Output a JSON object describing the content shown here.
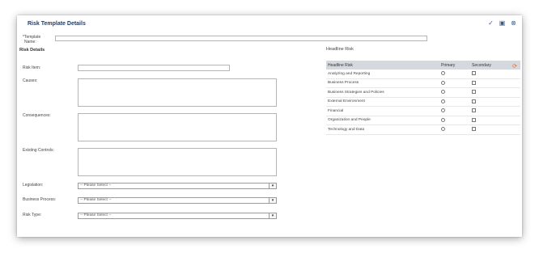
{
  "dialog": {
    "title": "Risk Template Details",
    "icons": [
      "spellcheck-icon",
      "save-icon",
      "close-icon"
    ]
  },
  "form": {
    "template_name_label_1": "*Template",
    "template_name_label_2": "Name:",
    "template_name_value": "",
    "section_title": "Risk Details",
    "risk_item_label": "Risk Item:",
    "causes_label": "Causes:",
    "consequences_label": "Consequences:",
    "existing_controls_label": "Existing Controls:",
    "legislation_label": "Legislation:",
    "legislation_value": "-- Please Select --",
    "business_process_label": "Business Process:",
    "business_process_value": "-- Please Select --",
    "risk_type_label": "Risk Type:",
    "risk_type_value": "-- Please Select --"
  },
  "headline": {
    "section_title": "Headline Risk",
    "columns": {
      "name": "Headline Risk",
      "primary": "Primary",
      "secondary": "Secondary"
    },
    "rows": [
      "Analyzing and Reporting",
      "Business Process",
      "Business Strategies and Policies",
      "External Environment",
      "Financial",
      "Organization and People",
      "Technology and Data"
    ]
  }
}
